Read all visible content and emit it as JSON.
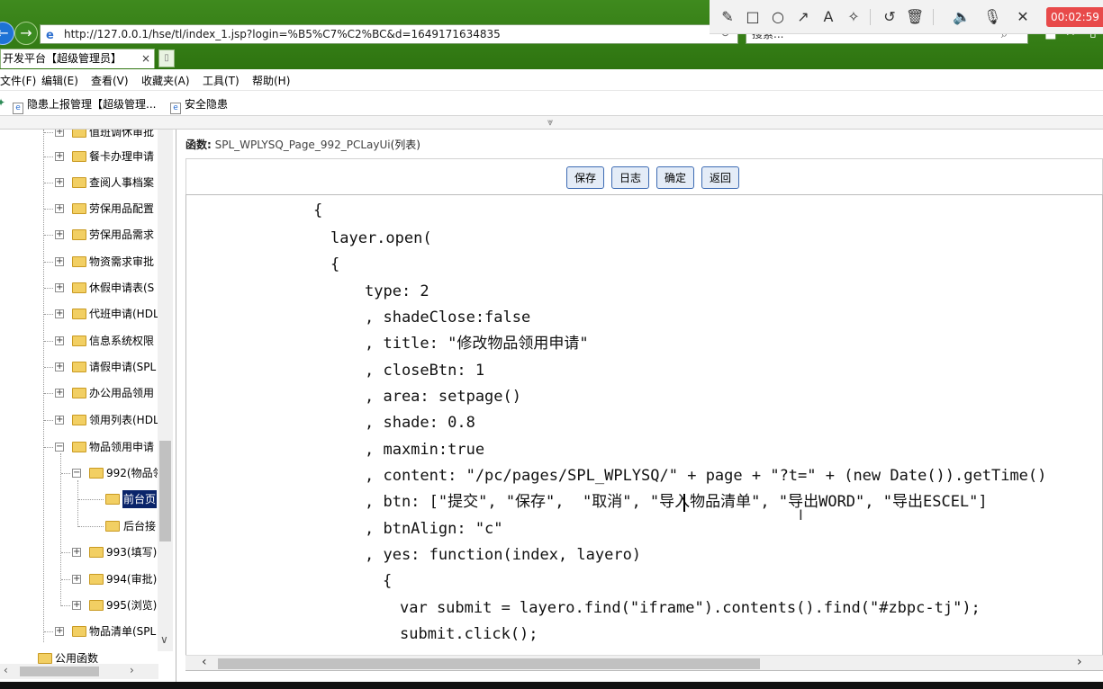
{
  "browser": {
    "url": "http://127.0.0.1/hse/tl/index_1.jsp?login=%B5%C7%C2%BC&d=1649171634835",
    "search_placeholder": "搜索...",
    "tab_title": "开发平台【超级管理员】",
    "tab_close": "×"
  },
  "menu": [
    "文件(F)",
    "编辑(E)",
    "查看(V)",
    "收藏夹(A)",
    "工具(T)",
    "帮助(H)"
  ],
  "favorites": [
    "隐患上报管理【超级管理...",
    "安全隐患"
  ],
  "recorder": {
    "timer": "00:02:59 结"
  },
  "tree": {
    "items": [
      "值班调休审批",
      "餐卡办理申请",
      "查阅人事档案",
      "劳保用品配置",
      "劳保用品需求",
      "物资需求审批",
      "休假申请表(S",
      "代班申请(HDL",
      "信息系统权限",
      "请假申请(SPL",
      "办公用品领用",
      "领用列表(HDL",
      "物品领用申请",
      "992(物品领",
      "前台页",
      "后台接",
      "993(填写)",
      "994(审批)",
      "995(浏览)",
      "物品清单(SPL",
      "公用函数"
    ]
  },
  "main": {
    "func_label": "函数:",
    "func_name": "SPL_WPLYSQ_Page_992_PCLayUi",
    "func_suffix": "(列表)",
    "buttons": {
      "save": "保存",
      "log": "日志",
      "confirm": "确定",
      "back": "返回"
    },
    "code_lines": [
      "{",
      "layer.open(",
      "{",
      "type: 2",
      ", shadeClose:false",
      ", title: \"修改物品领用申请\"",
      ", closeBtn: 1",
      ", area: setpage()",
      ", shade: 0.8",
      ", maxmin:true",
      ", content: \"/pc/pages/SPL_WPLYSQ/\" + page + \"?t=\" + (new Date()).getTime()",
      ", btn: [\"提交\", \"保存\",  \"取消\", \"导入物品清单\", \"导出WORD\", \"导出ESCEL\"]",
      ", btnAlign: \"c\"",
      ", yes: function(index, layero)",
      "{",
      "var submit = layero.find(\"iframe\").contents().find(\"#zbpc-tj\");",
      "submit.click();"
    ]
  }
}
